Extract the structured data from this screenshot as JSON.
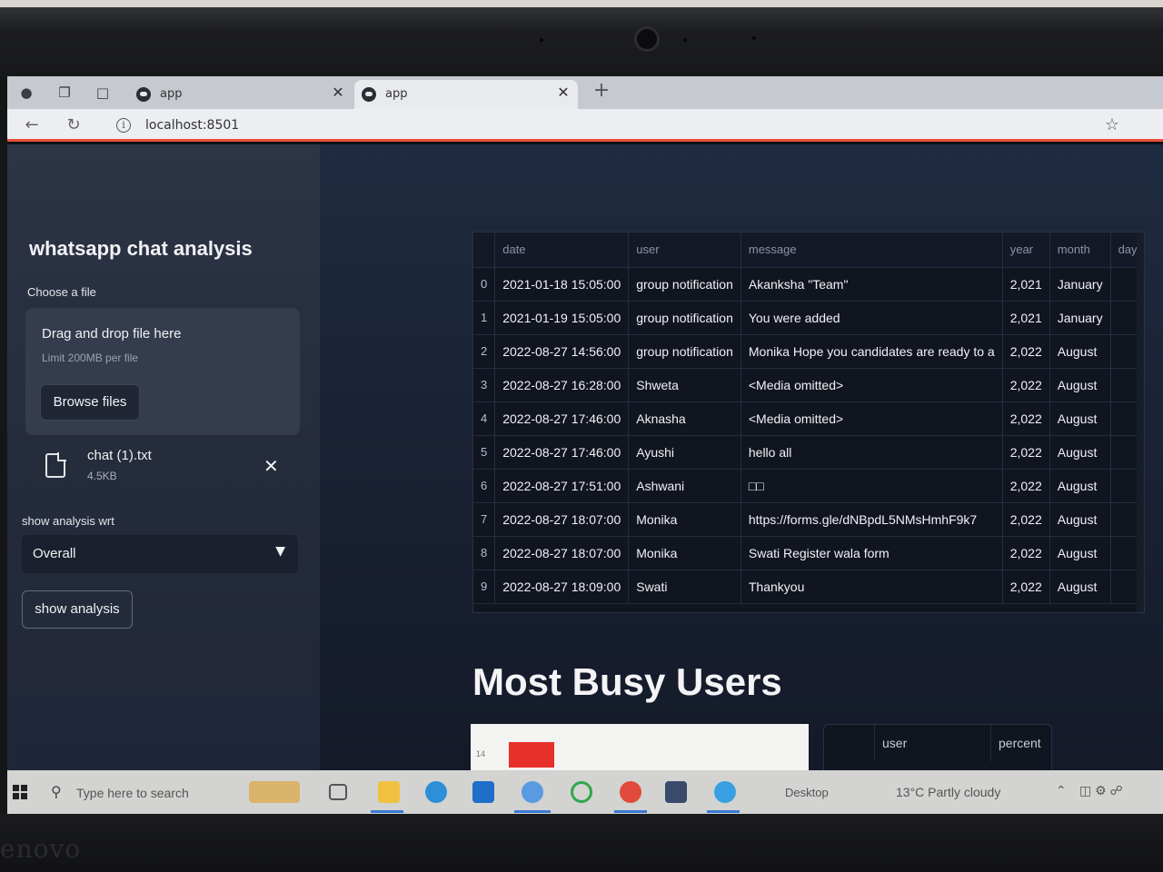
{
  "browser": {
    "tabs": [
      {
        "title": "app"
      },
      {
        "title": "app"
      }
    ],
    "new_tab": "+",
    "url": "localhost:8501"
  },
  "sidebar": {
    "title": "whatsapp chat analysis",
    "choose_file_label": "Choose a file",
    "dropzone_title": "Drag and drop file here",
    "dropzone_limit": "Limit 200MB per file",
    "browse_button": "Browse files",
    "file_name": "chat (1).txt",
    "file_size": "4.5KB",
    "analysis_label": "show analysis wrt",
    "analysis_selected": "Overall",
    "show_analysis_button": "show analysis"
  },
  "dataframe": {
    "columns": [
      "",
      "date",
      "user",
      "message",
      "year",
      "month",
      "day"
    ],
    "rows": [
      {
        "idx": "0",
        "date": "2021-01-18 15:05:00",
        "user": "group notification",
        "message": "Akanksha \"Team\"",
        "year": "2,021",
        "month": "January"
      },
      {
        "idx": "1",
        "date": "2021-01-19 15:05:00",
        "user": "group notification",
        "message": "You were added",
        "year": "2,021",
        "month": "January"
      },
      {
        "idx": "2",
        "date": "2022-08-27 14:56:00",
        "user": "group notification",
        "message": "Monika  Hope you candidates are ready to a",
        "year": "2,022",
        "month": "August"
      },
      {
        "idx": "3",
        "date": "2022-08-27 16:28:00",
        "user": "Shweta",
        "message": "<Media omitted>",
        "year": "2,022",
        "month": "August"
      },
      {
        "idx": "4",
        "date": "2022-08-27 17:46:00",
        "user": "Aknasha",
        "message": "<Media omitted>",
        "year": "2,022",
        "month": "August"
      },
      {
        "idx": "5",
        "date": "2022-08-27 17:46:00",
        "user": "Ayushi",
        "message": "hello all",
        "year": "2,022",
        "month": "August"
      },
      {
        "idx": "6",
        "date": "2022-08-27 17:51:00",
        "user": "Ashwani",
        "message": "□□",
        "year": "2,022",
        "month": "August"
      },
      {
        "idx": "7",
        "date": "2022-08-27 18:07:00",
        "user": "Monika",
        "message": "https://forms.gle/dNBpdL5NMsHmhF9k7",
        "year": "2,022",
        "month": "August"
      },
      {
        "idx": "8",
        "date": "2022-08-27 18:07:00",
        "user": "Monika",
        "message": "Swati  Register wala form",
        "year": "2,022",
        "month": "August"
      },
      {
        "idx": "9",
        "date": "2022-08-27 18:09:00",
        "user": "Swati",
        "message": "Thankyou",
        "year": "2,022",
        "month": "August"
      }
    ]
  },
  "busy_users": {
    "heading": "Most Busy Users",
    "chart_tick": "14",
    "bar_color": "#e8302a",
    "table_columns": [
      "",
      "user",
      "percent"
    ]
  },
  "taskbar": {
    "search_placeholder": "Type here to search",
    "desktop_label": "Desktop",
    "weather": "13°C  Partly cloudy"
  },
  "laptop_brand": "Lenovo"
}
